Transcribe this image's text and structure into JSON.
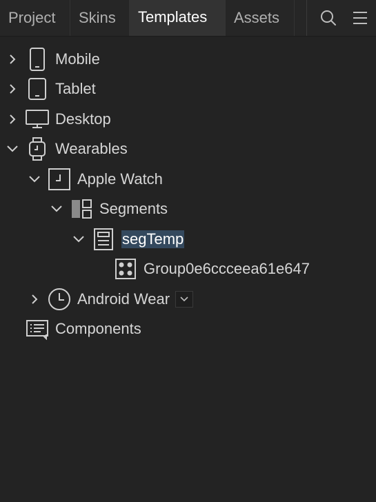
{
  "tabs": [
    {
      "label": "Project",
      "active": false
    },
    {
      "label": "Skins",
      "active": false
    },
    {
      "label": "Templates",
      "active": true
    },
    {
      "label": "Assets",
      "active": false
    }
  ],
  "toolbar": {
    "search_icon": "search-icon",
    "menu_icon": "hamburger-menu-icon"
  },
  "tree": {
    "mobile": {
      "label": "Mobile",
      "expanded": false,
      "icon": "phone-icon"
    },
    "tablet": {
      "label": "Tablet",
      "expanded": false,
      "icon": "tablet-icon"
    },
    "desktop": {
      "label": "Desktop",
      "expanded": false,
      "icon": "monitor-icon"
    },
    "wearables": {
      "label": "Wearables",
      "expanded": true,
      "icon": "watch-icon"
    },
    "apple_watch": {
      "label": "Apple Watch",
      "expanded": true,
      "icon": "watch-face-icon"
    },
    "segments": {
      "label": "Segments",
      "expanded": true,
      "icon": "segments-icon"
    },
    "segtemp": {
      "label": "segTemp",
      "expanded": true,
      "selected": true,
      "icon": "template-icon"
    },
    "group": {
      "label": "Group0e6ccceea61e647",
      "icon": "group-icon"
    },
    "android_wear": {
      "label": "Android Wear",
      "expanded": false,
      "icon": "clock-icon"
    },
    "components": {
      "label": "Components",
      "icon": "components-icon"
    }
  },
  "colors": {
    "background": "#232323",
    "tab_active": "#333333",
    "selection": "#34495e",
    "text": "#d6d6d6"
  }
}
